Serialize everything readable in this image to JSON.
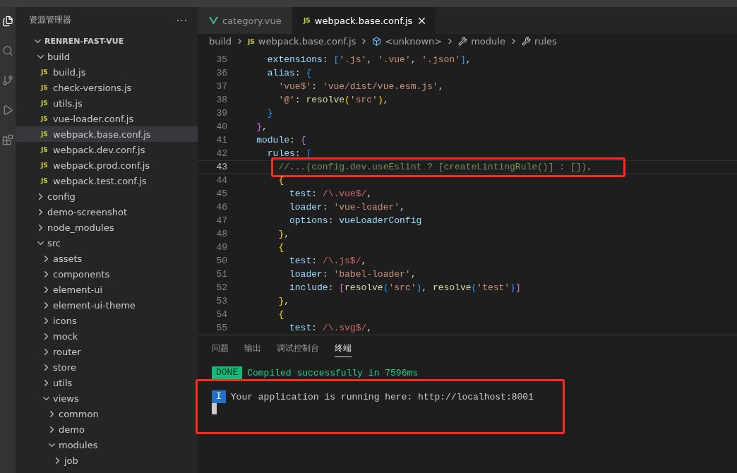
{
  "sidebar": {
    "title": "资源管理器",
    "more": "···",
    "root": {
      "label": "RENREN-FAST-VUE",
      "expanded": true
    },
    "tree": [
      {
        "label": "build",
        "kind": "folder",
        "expanded": true,
        "selected": false,
        "children": [
          {
            "label": "build.js",
            "kind": "js",
            "icon_text": "JS",
            "selected": false
          },
          {
            "label": "check-versions.js",
            "kind": "js",
            "icon_text": "JS",
            "selected": false
          },
          {
            "label": "utils.js",
            "kind": "js",
            "icon_text": "JS",
            "selected": false
          },
          {
            "label": "vue-loader.conf.js",
            "kind": "js",
            "icon_text": "JS",
            "selected": false
          },
          {
            "label": "webpack.base.conf.js",
            "kind": "js",
            "icon_text": "JS",
            "selected": true
          },
          {
            "label": "webpack.dev.conf.js",
            "kind": "js",
            "icon_text": "JS",
            "selected": false
          },
          {
            "label": "webpack.prod.conf.js",
            "kind": "js",
            "icon_text": "JS",
            "selected": false
          },
          {
            "label": "webpack.test.conf.js",
            "kind": "js",
            "icon_text": "JS",
            "selected": false
          }
        ]
      },
      {
        "label": "config",
        "kind": "folder",
        "expanded": false,
        "selected": false
      },
      {
        "label": "demo-screenshot",
        "kind": "folder",
        "expanded": false,
        "selected": false
      },
      {
        "label": "node_modules",
        "kind": "folder",
        "expanded": false,
        "selected": false
      },
      {
        "label": "src",
        "kind": "folder",
        "expanded": true,
        "selected": false,
        "children": [
          {
            "label": "assets",
            "kind": "folder",
            "expanded": false,
            "selected": false
          },
          {
            "label": "components",
            "kind": "folder",
            "expanded": false,
            "selected": false
          },
          {
            "label": "element-ui",
            "kind": "folder",
            "expanded": false,
            "selected": false
          },
          {
            "label": "element-ui-theme",
            "kind": "folder",
            "expanded": false,
            "selected": false
          },
          {
            "label": "icons",
            "kind": "folder",
            "expanded": false,
            "selected": false
          },
          {
            "label": "mock",
            "kind": "folder",
            "expanded": false,
            "selected": false
          },
          {
            "label": "router",
            "kind": "folder",
            "expanded": false,
            "selected": false
          },
          {
            "label": "store",
            "kind": "folder",
            "expanded": false,
            "selected": false
          },
          {
            "label": "utils",
            "kind": "folder",
            "expanded": false,
            "selected": false
          },
          {
            "label": "views",
            "kind": "folder",
            "expanded": true,
            "selected": false,
            "children": [
              {
                "label": "common",
                "kind": "folder",
                "expanded": false,
                "selected": false
              },
              {
                "label": "demo",
                "kind": "folder",
                "expanded": false,
                "selected": false
              },
              {
                "label": "modules",
                "kind": "folder",
                "expanded": true,
                "selected": false,
                "children": [
                  {
                    "label": "job",
                    "kind": "folder",
                    "expanded": false,
                    "selected": false
                  }
                ]
              }
            ]
          }
        ]
      }
    ]
  },
  "tabs": [
    {
      "label": "category.vue",
      "kind": "vue",
      "selected": false
    },
    {
      "label": "webpack.base.conf.js",
      "kind": "js",
      "icon_text": "JS",
      "selected": true
    }
  ],
  "breadcrumb": [
    {
      "label": "build",
      "kind": "folder"
    },
    {
      "label": "webpack.base.conf.js",
      "kind": "js",
      "icon_text": "JS"
    },
    {
      "label": "<unknown>",
      "kind": "object"
    },
    {
      "label": "module",
      "kind": "wrench"
    },
    {
      "label": "rules",
      "kind": "wrench"
    }
  ],
  "code": [
    {
      "no": "35",
      "current": false,
      "boxed": false,
      "tokens": [
        {
          "t": "      extensions",
          "kind": "key"
        },
        {
          "t": ": ",
          "kind": "p"
        },
        {
          "t": "[",
          "kind": "b3"
        },
        {
          "t": "'.js'",
          "kind": "str"
        },
        {
          "t": ", ",
          "kind": "p"
        },
        {
          "t": "'.vue'",
          "kind": "str"
        },
        {
          "t": ", ",
          "kind": "p"
        },
        {
          "t": "'.json'",
          "kind": "str"
        },
        {
          "t": "]",
          "kind": "b3"
        },
        {
          "t": ",",
          "kind": "p"
        }
      ]
    },
    {
      "no": "36",
      "current": false,
      "boxed": false,
      "tokens": [
        {
          "t": "      alias",
          "kind": "key"
        },
        {
          "t": ": ",
          "kind": "p"
        },
        {
          "t": "{",
          "kind": "b3"
        }
      ]
    },
    {
      "no": "37",
      "current": false,
      "boxed": false,
      "tokens": [
        {
          "t": "        'vue$'",
          "kind": "str"
        },
        {
          "t": ": ",
          "kind": "p"
        },
        {
          "t": "'vue/dist/vue.esm.js'",
          "kind": "str"
        },
        {
          "t": ",",
          "kind": "p"
        }
      ]
    },
    {
      "no": "38",
      "current": false,
      "boxed": false,
      "tokens": [
        {
          "t": "        '@'",
          "kind": "str"
        },
        {
          "t": ": ",
          "kind": "p"
        },
        {
          "t": "resolve",
          "kind": "fn"
        },
        {
          "t": "(",
          "kind": "b1"
        },
        {
          "t": "'src'",
          "kind": "str"
        },
        {
          "t": ")",
          "kind": "b1"
        },
        {
          "t": ",",
          "kind": "p"
        }
      ]
    },
    {
      "no": "39",
      "current": false,
      "boxed": false,
      "tokens": [
        {
          "t": "      }",
          "kind": "b3"
        }
      ]
    },
    {
      "no": "40",
      "current": false,
      "boxed": false,
      "tokens": [
        {
          "t": "    }",
          "kind": "b2"
        },
        {
          "t": ",",
          "kind": "p"
        }
      ]
    },
    {
      "no": "41",
      "current": false,
      "boxed": false,
      "tokens": [
        {
          "t": "    module",
          "kind": "key"
        },
        {
          "t": ": ",
          "kind": "p"
        },
        {
          "t": "{",
          "kind": "b2"
        }
      ]
    },
    {
      "no": "42",
      "current": false,
      "boxed": false,
      "tokens": [
        {
          "t": "      rules",
          "kind": "key"
        },
        {
          "t": ": ",
          "kind": "p"
        },
        {
          "t": "[",
          "kind": "b3"
        }
      ]
    },
    {
      "no": "43",
      "current": true,
      "boxed": true,
      "tokens": [
        {
          "t": "        //...(config.dev.useEslint ? [createLintingRule()] : []),",
          "kind": "comment"
        }
      ]
    },
    {
      "no": "44",
      "current": false,
      "boxed": false,
      "tokens": [
        {
          "t": "        {",
          "kind": "b1"
        }
      ]
    },
    {
      "no": "45",
      "current": false,
      "boxed": false,
      "tokens": [
        {
          "t": "          test",
          "kind": "key"
        },
        {
          "t": ": ",
          "kind": "p"
        },
        {
          "t": "/\\.vue$/",
          "kind": "regex"
        },
        {
          "t": ",",
          "kind": "p"
        }
      ]
    },
    {
      "no": "46",
      "current": false,
      "boxed": false,
      "tokens": [
        {
          "t": "          loader",
          "kind": "key"
        },
        {
          "t": ": ",
          "kind": "p"
        },
        {
          "t": "'vue-loader'",
          "kind": "str"
        },
        {
          "t": ",",
          "kind": "p"
        }
      ]
    },
    {
      "no": "47",
      "current": false,
      "boxed": false,
      "tokens": [
        {
          "t": "          options",
          "kind": "key"
        },
        {
          "t": ": ",
          "kind": "p"
        },
        {
          "t": "vueLoaderConfig",
          "kind": "key"
        }
      ]
    },
    {
      "no": "48",
      "current": false,
      "boxed": false,
      "tokens": [
        {
          "t": "        }",
          "kind": "b1"
        },
        {
          "t": ",",
          "kind": "p"
        }
      ]
    },
    {
      "no": "49",
      "current": false,
      "boxed": false,
      "tokens": [
        {
          "t": "        {",
          "kind": "b1"
        }
      ]
    },
    {
      "no": "50",
      "current": false,
      "boxed": false,
      "tokens": [
        {
          "t": "          test",
          "kind": "key"
        },
        {
          "t": ": ",
          "kind": "p"
        },
        {
          "t": "/\\.js$/",
          "kind": "regex"
        },
        {
          "t": ",",
          "kind": "p"
        }
      ]
    },
    {
      "no": "51",
      "current": false,
      "boxed": false,
      "tokens": [
        {
          "t": "          loader",
          "kind": "key"
        },
        {
          "t": ": ",
          "kind": "p"
        },
        {
          "t": "'babel-loader'",
          "kind": "str"
        },
        {
          "t": ",",
          "kind": "p"
        }
      ]
    },
    {
      "no": "52",
      "current": false,
      "boxed": false,
      "tokens": [
        {
          "t": "          include",
          "kind": "key"
        },
        {
          "t": ": ",
          "kind": "p"
        },
        {
          "t": "[",
          "kind": "b2"
        },
        {
          "t": "resolve",
          "kind": "fn"
        },
        {
          "t": "(",
          "kind": "b3"
        },
        {
          "t": "'src'",
          "kind": "str"
        },
        {
          "t": ")",
          "kind": "b3"
        },
        {
          "t": ", ",
          "kind": "p"
        },
        {
          "t": "resolve",
          "kind": "fn"
        },
        {
          "t": "(",
          "kind": "b3"
        },
        {
          "t": "'test'",
          "kind": "str"
        },
        {
          "t": ")",
          "kind": "b3"
        },
        {
          "t": "]",
          "kind": "b2"
        }
      ]
    },
    {
      "no": "53",
      "current": false,
      "boxed": false,
      "tokens": [
        {
          "t": "        }",
          "kind": "b1"
        },
        {
          "t": ",",
          "kind": "p"
        }
      ]
    },
    {
      "no": "54",
      "current": false,
      "boxed": false,
      "tokens": [
        {
          "t": "        {",
          "kind": "b1"
        }
      ]
    },
    {
      "no": "55",
      "current": false,
      "boxed": false,
      "tokens": [
        {
          "t": "          test",
          "kind": "key"
        },
        {
          "t": ": ",
          "kind": "p"
        },
        {
          "t": "/\\.svg$/",
          "kind": "regex"
        },
        {
          "t": ",",
          "kind": "p"
        }
      ]
    }
  ],
  "panel": {
    "tabs": [
      {
        "label": "问题",
        "selected": false
      },
      {
        "label": "输出",
        "selected": false
      },
      {
        "label": "调试控制台",
        "selected": false
      },
      {
        "label": "终端",
        "selected": true
      }
    ],
    "terminal": [
      {
        "badge": "DONE",
        "kind": "done",
        "text": "Compiled successfully in 7596ms",
        "boxed": false
      },
      {
        "badge": "I",
        "kind": "info",
        "text": "Your application is running here: http://localhost:8001",
        "boxed": true
      }
    ],
    "cursor": true
  }
}
